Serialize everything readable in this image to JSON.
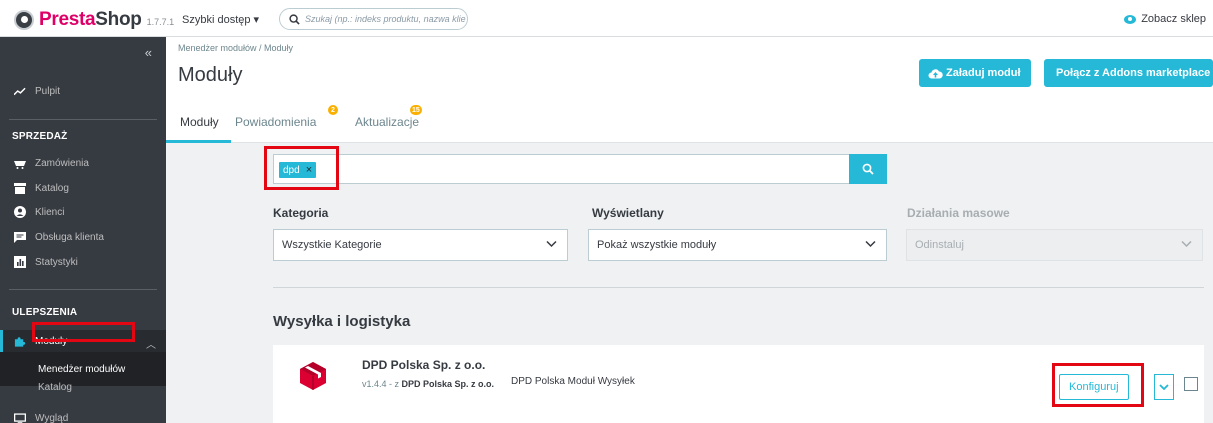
{
  "topbar": {
    "logo_presta": "Presta",
    "logo_shop": "Shop",
    "version": "1.7.7.1",
    "quick_access": "Szybki dostęp ▾",
    "search_placeholder": "Szukaj (np.: indeks produktu, nazwa klie",
    "view_shop": "Zobacz sklep"
  },
  "sidebar": {
    "collapse": "«",
    "dashboard": "Pulpit",
    "section_sales": "SPRZEDAŻ",
    "sales_items": [
      "Zamówienia",
      "Katalog",
      "Klienci",
      "Obsługa klienta",
      "Statystyki"
    ],
    "section_improve": "ULEPSZENIA",
    "modules": "Moduły",
    "sub_items": [
      "Menedżer modułów",
      "Katalog"
    ],
    "appearance": "Wygląd"
  },
  "header": {
    "breadcrumb": "Menedżer modułów  /  Moduły",
    "title": "Moduły",
    "upload_button": "Załaduj moduł",
    "connect_button": "Połącz z Addons marketplace"
  },
  "tabs": [
    {
      "label": "Moduły",
      "badge": ""
    },
    {
      "label": "Powiadomienia",
      "badge": "2"
    },
    {
      "label": "Aktualizacje",
      "badge": "15"
    }
  ],
  "filter": {
    "tag": "dpd",
    "tag_remove": "×"
  },
  "fields": {
    "category_label": "Kategoria",
    "category_value": "Wszystkie Kategorie",
    "display_label": "Wyświetlany",
    "display_value": "Pokaż wszystkie moduły",
    "bulk_label": "Działania masowe",
    "bulk_value": "Odinstaluj"
  },
  "section": {
    "title": "Wysyłka i logistyka"
  },
  "module": {
    "name": "DPD Polska Sp. z o.o.",
    "version_prefix": "v1.4.4 - z ",
    "author": "DPD Polska Sp. z o.o.",
    "description": "DPD Polska Moduł Wysyłek",
    "configure_button": "Konfiguruj"
  },
  "colors": {
    "accent": "#25b9d7",
    "highlight": "#e30613",
    "sidebar": "#363a41",
    "brand": "#df0067",
    "badge": "#fab000",
    "dpd_red": "#dc0032"
  }
}
